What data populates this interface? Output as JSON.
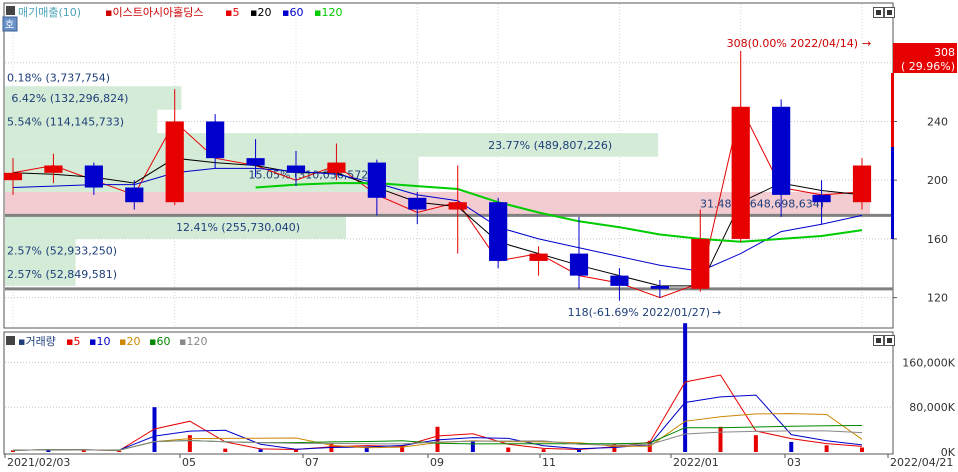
{
  "app": {
    "indicator_label": "매기매출(10)",
    "stock_name": "이스트아시아홀딩스",
    "ma_legend": [
      {
        "label": "5",
        "color": "#e60000"
      },
      {
        "label": "20",
        "color": "#000000"
      },
      {
        "label": "60",
        "color": "#0000cc"
      },
      {
        "label": "120",
        "color": "#00cc00"
      }
    ],
    "toggle_label": "호"
  },
  "volume_panel": {
    "title": "거래량",
    "legend": [
      {
        "label": "5",
        "color": "#e60000"
      },
      {
        "label": "10",
        "color": "#0000cc"
      },
      {
        "label": "20",
        "color": "#cc8800"
      },
      {
        "label": "60",
        "color": "#008800"
      },
      {
        "label": "120",
        "color": "#888888"
      }
    ]
  },
  "chart_data": [
    {
      "type": "candlestick",
      "title": "이스트아시아홀딩스",
      "ylim": [
        100,
        320
      ],
      "y_ticks": [
        120,
        160,
        200,
        240,
        280
      ],
      "x_tick_labels": [
        "2021/02/03",
        "05",
        "07",
        "09",
        "11",
        "2022/01",
        "03",
        "2022/04/21"
      ],
      "current_price": {
        "value": "308",
        "change": "( 29.96%)"
      },
      "annotations": [
        {
          "text": "308(0.00% 2022/04/14)",
          "price": 308,
          "date": "2022/04/14"
        },
        {
          "text": "118(-61.69% 2022/01/27)",
          "price": 118,
          "date": "2022/01/27"
        }
      ],
      "volume_profile": [
        {
          "label": "0.18% (3,737,754)",
          "price_from": 270,
          "price_to": 270,
          "pct": 0.18
        },
        {
          "label": "6.42% (132,296,824)",
          "price_from": 248,
          "price_to": 264,
          "pct": 6.42
        },
        {
          "label": "5.54% (114,145,733)",
          "price_from": 232,
          "price_to": 248,
          "pct": 5.54
        },
        {
          "label": "23.77% (489,807,226)",
          "price_from": 216,
          "price_to": 232,
          "pct": 23.77
        },
        {
          "label": "15.05% (310,036,572)",
          "price_from": 192,
          "price_to": 216,
          "pct": 15.05
        },
        {
          "label": "31.48% (648,698,634)",
          "price_from": 176,
          "price_to": 192,
          "pct": 31.48
        },
        {
          "label": "12.41% (255,730,040)",
          "price_from": 160,
          "price_to": 176,
          "pct": 12.41
        },
        {
          "label": "2.57% (52,933,250)",
          "price_from": 144,
          "price_to": 160,
          "pct": 2.57
        },
        {
          "label": "2.57% (52,849,581)",
          "price_from": 128,
          "price_to": 144,
          "pct": 2.57
        }
      ],
      "horizontal_lines": [
        176,
        126
      ],
      "series": [
        {
          "name": "5",
          "values": [
            205,
            210,
            200,
            190,
            240,
            215,
            210,
            200,
            210,
            190,
            178,
            185,
            145,
            150,
            135,
            130,
            120,
            130,
            250,
            195,
            190,
            192
          ]
        },
        {
          "name": "20",
          "values": [
            205,
            204,
            202,
            198,
            215,
            212,
            210,
            205,
            205,
            195,
            185,
            182,
            158,
            150,
            142,
            135,
            128,
            128,
            185,
            198,
            193,
            190
          ]
        },
        {
          "name": "60",
          "values": [
            195,
            196,
            197,
            197,
            205,
            208,
            208,
            206,
            204,
            198,
            190,
            186,
            168,
            160,
            154,
            148,
            142,
            138,
            150,
            165,
            170,
            176
          ]
        },
        {
          "name": "120",
          "values": [
            null,
            null,
            null,
            null,
            null,
            null,
            195,
            197,
            198,
            198,
            196,
            194,
            185,
            178,
            172,
            168,
            163,
            160,
            158,
            160,
            162,
            166
          ]
        }
      ],
      "candles": [
        {
          "date": "2021/02",
          "o": 200,
          "h": 215,
          "l": 190,
          "c": 205
        },
        {
          "date": "2021/02b",
          "o": 205,
          "h": 218,
          "l": 198,
          "c": 210
        },
        {
          "date": "2021/03",
          "o": 210,
          "h": 212,
          "l": 190,
          "c": 195
        },
        {
          "date": "2021/04",
          "o": 195,
          "h": 200,
          "l": 180,
          "c": 185
        },
        {
          "date": "2021/05",
          "o": 185,
          "h": 262,
          "l": 183,
          "c": 240
        },
        {
          "date": "2021/05b",
          "o": 240,
          "h": 245,
          "l": 208,
          "c": 215
        },
        {
          "date": "2021/06",
          "o": 215,
          "h": 228,
          "l": 202,
          "c": 210
        },
        {
          "date": "2021/07",
          "o": 210,
          "h": 220,
          "l": 196,
          "c": 205
        },
        {
          "date": "2021/07b",
          "o": 205,
          "h": 225,
          "l": 200,
          "c": 212
        },
        {
          "date": "2021/08",
          "o": 212,
          "h": 214,
          "l": 176,
          "c": 188
        },
        {
          "date": "2021/09",
          "o": 188,
          "h": 192,
          "l": 170,
          "c": 180
        },
        {
          "date": "2021/10",
          "o": 180,
          "h": 210,
          "l": 150,
          "c": 185
        },
        {
          "date": "2021/11",
          "o": 185,
          "h": 188,
          "l": 140,
          "c": 145
        },
        {
          "date": "2021/12",
          "o": 145,
          "h": 155,
          "l": 135,
          "c": 150
        },
        {
          "date": "2022/01",
          "o": 150,
          "h": 175,
          "l": 126,
          "c": 135
        },
        {
          "date": "2022/01b",
          "o": 135,
          "h": 140,
          "l": 118,
          "c": 128
        },
        {
          "date": "2022/02",
          "o": 128,
          "h": 132,
          "l": 120,
          "c": 126
        },
        {
          "date": "2022/02b",
          "o": 126,
          "h": 180,
          "l": 124,
          "c": 160
        },
        {
          "date": "2022/03",
          "o": 160,
          "h": 288,
          "l": 158,
          "c": 250
        },
        {
          "date": "2022/03b",
          "o": 250,
          "h": 255,
          "l": 175,
          "c": 190
        },
        {
          "date": "2022/04",
          "o": 190,
          "h": 200,
          "l": 170,
          "c": 185
        },
        {
          "date": "2022/04b",
          "o": 185,
          "h": 215,
          "l": 180,
          "c": 210
        }
      ]
    },
    {
      "type": "bar",
      "title": "거래량",
      "ylim": [
        0,
        200000
      ],
      "y_tick_labels": [
        "160,000K",
        "80,000K",
        "0K"
      ],
      "y_ticks": [
        160000,
        80000,
        0
      ],
      "volumes": [
        3000,
        5000,
        3000,
        2000,
        80000,
        30000,
        6000,
        5000,
        4000,
        15000,
        8000,
        12000,
        45000,
        20000,
        8000,
        5000,
        4000,
        15000,
        20000,
        230000,
        45000,
        30000,
        18000,
        12000,
        8000
      ]
    }
  ]
}
